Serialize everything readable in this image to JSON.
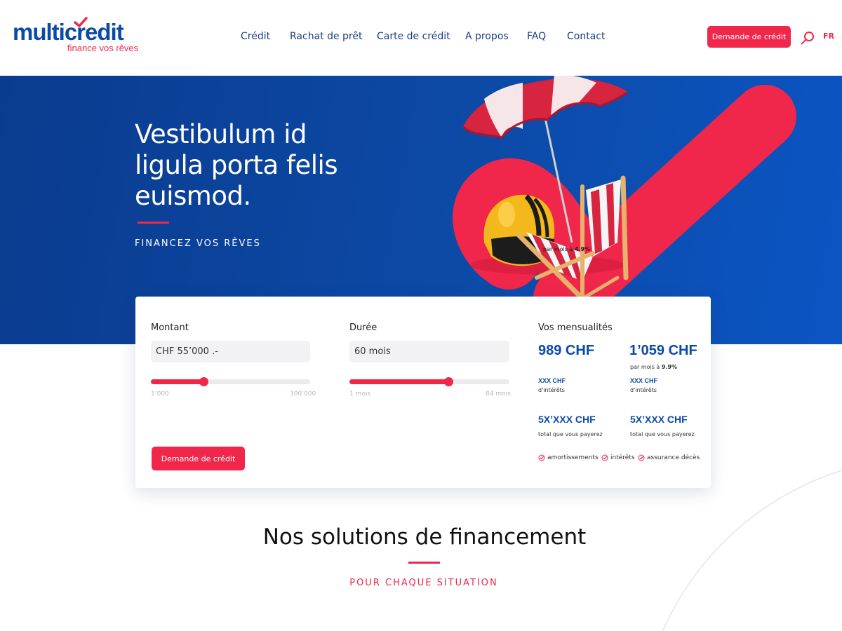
{
  "brand": {
    "name": "multicredit",
    "tagline": "finance vos rêves",
    "primary_color": "#0c4aa7",
    "accent_color": "#f0274a"
  },
  "nav": {
    "items": [
      "Crédit",
      "Rachat de prêt",
      "Carte de crédit",
      "A propos",
      "FAQ",
      "Contact"
    ],
    "cta_label": "Demande de crédit",
    "search_icon": "search-icon",
    "language": "FR"
  },
  "hero": {
    "title": "Vestibulum id ligula porta felis euismod.",
    "subtitle": "FINANCEZ VOS RÊVES",
    "promo_text": "par mois à ",
    "promo_rate": "4.9%"
  },
  "calculator": {
    "amount": {
      "label": "Montant",
      "value": "CHF 55’000 .-",
      "min_label": "1’000",
      "max_label": "300’000",
      "fraction": 0.33
    },
    "duration": {
      "label": "Durée",
      "value": "60 mois",
      "min_label": "1 mois",
      "max_label": "84 mois",
      "fraction": 0.62
    },
    "cta_label": "Demande de crédit",
    "results": {
      "title": "Vos mensualités",
      "col1": {
        "monthly": "989 CHF",
        "interest_value": "XXX CHF",
        "interest_label": "d'intérêts",
        "total_value": "5X’XXX CHF",
        "total_label": "total que vous payerez"
      },
      "col2": {
        "monthly": "1’059 CHF",
        "rate_text": "par mois à ",
        "rate_value": "9.9%",
        "interest_value": "XXX CHF",
        "interest_label": "d'intérêts",
        "total_value": "5X’XXX CHF",
        "total_label": "total que vous payerez"
      },
      "includes": [
        "amortissements",
        "intérêts",
        "assurance décès"
      ]
    }
  },
  "solutions": {
    "title": "Nos solutions de financement",
    "subtitle": "POUR CHAQUE SITUATION"
  }
}
